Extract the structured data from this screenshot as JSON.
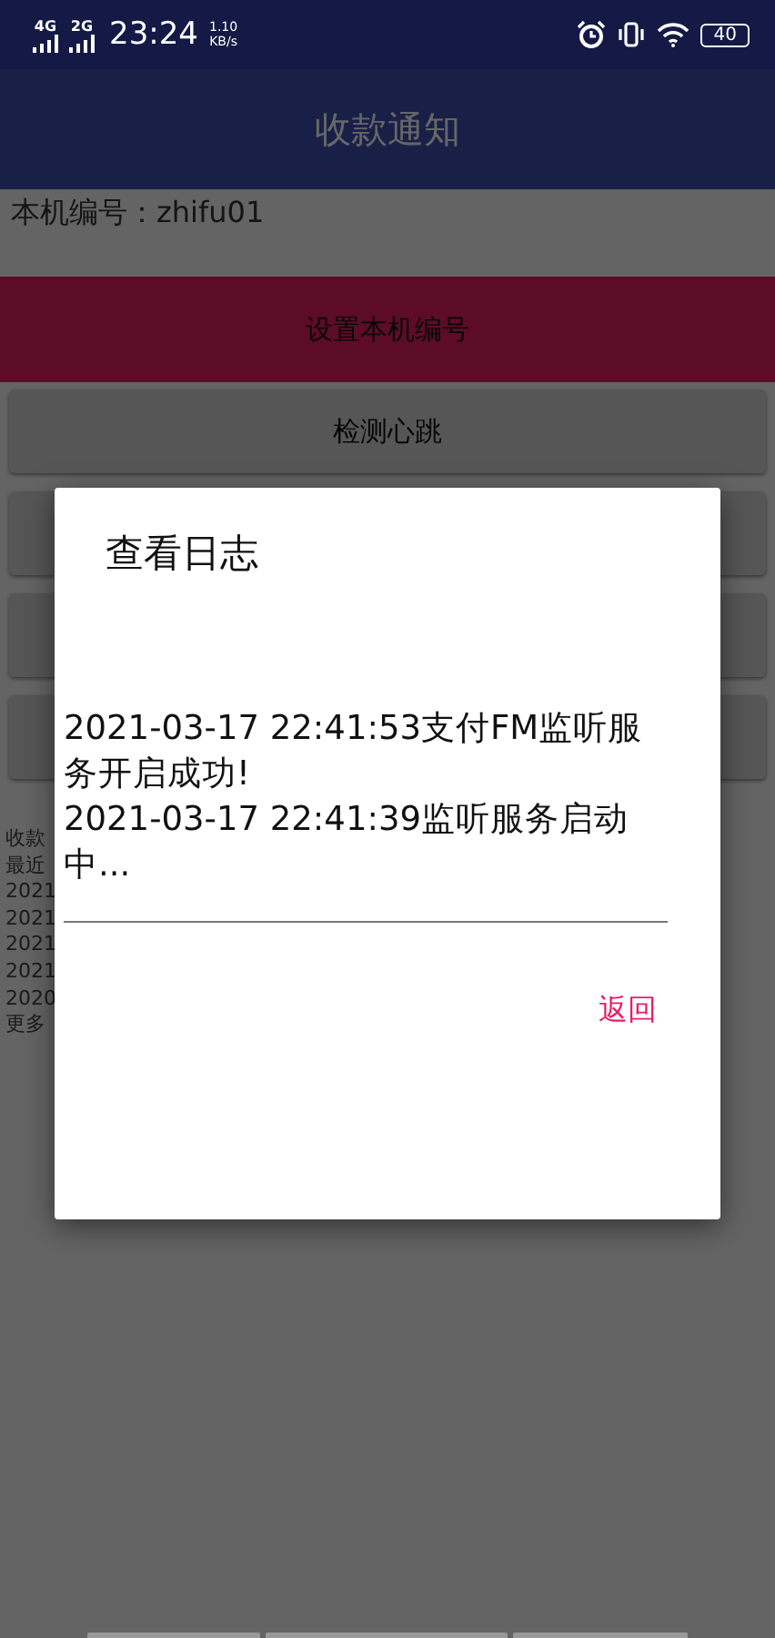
{
  "status_bar": {
    "network_1": "4G",
    "network_2": "2G",
    "time": "23:24",
    "speed_value": "1.10",
    "speed_unit": "KB/s",
    "battery": "40"
  },
  "toolbar": {
    "title": "收款通知"
  },
  "device_label": "本机编号：zhifu01",
  "buttons": [
    {
      "label": "设置本机编号",
      "kind": "primary"
    },
    {
      "label": "检测心跳",
      "kind": "plain"
    },
    {
      "kind": "plain"
    },
    {
      "kind": "plain"
    },
    {
      "kind": "plain"
    }
  ],
  "info_lines": [
    "收款",
    "最近",
    "2021",
    "2021",
    "2021",
    "2021",
    "2020",
    "更多"
  ],
  "dialog": {
    "title": "查看日志",
    "log": [
      "2021-03-17 22:41:53支付FM监听服务开启成功!",
      "2021-03-17 22:41:39监听服务启动中..."
    ],
    "action": "返回"
  }
}
